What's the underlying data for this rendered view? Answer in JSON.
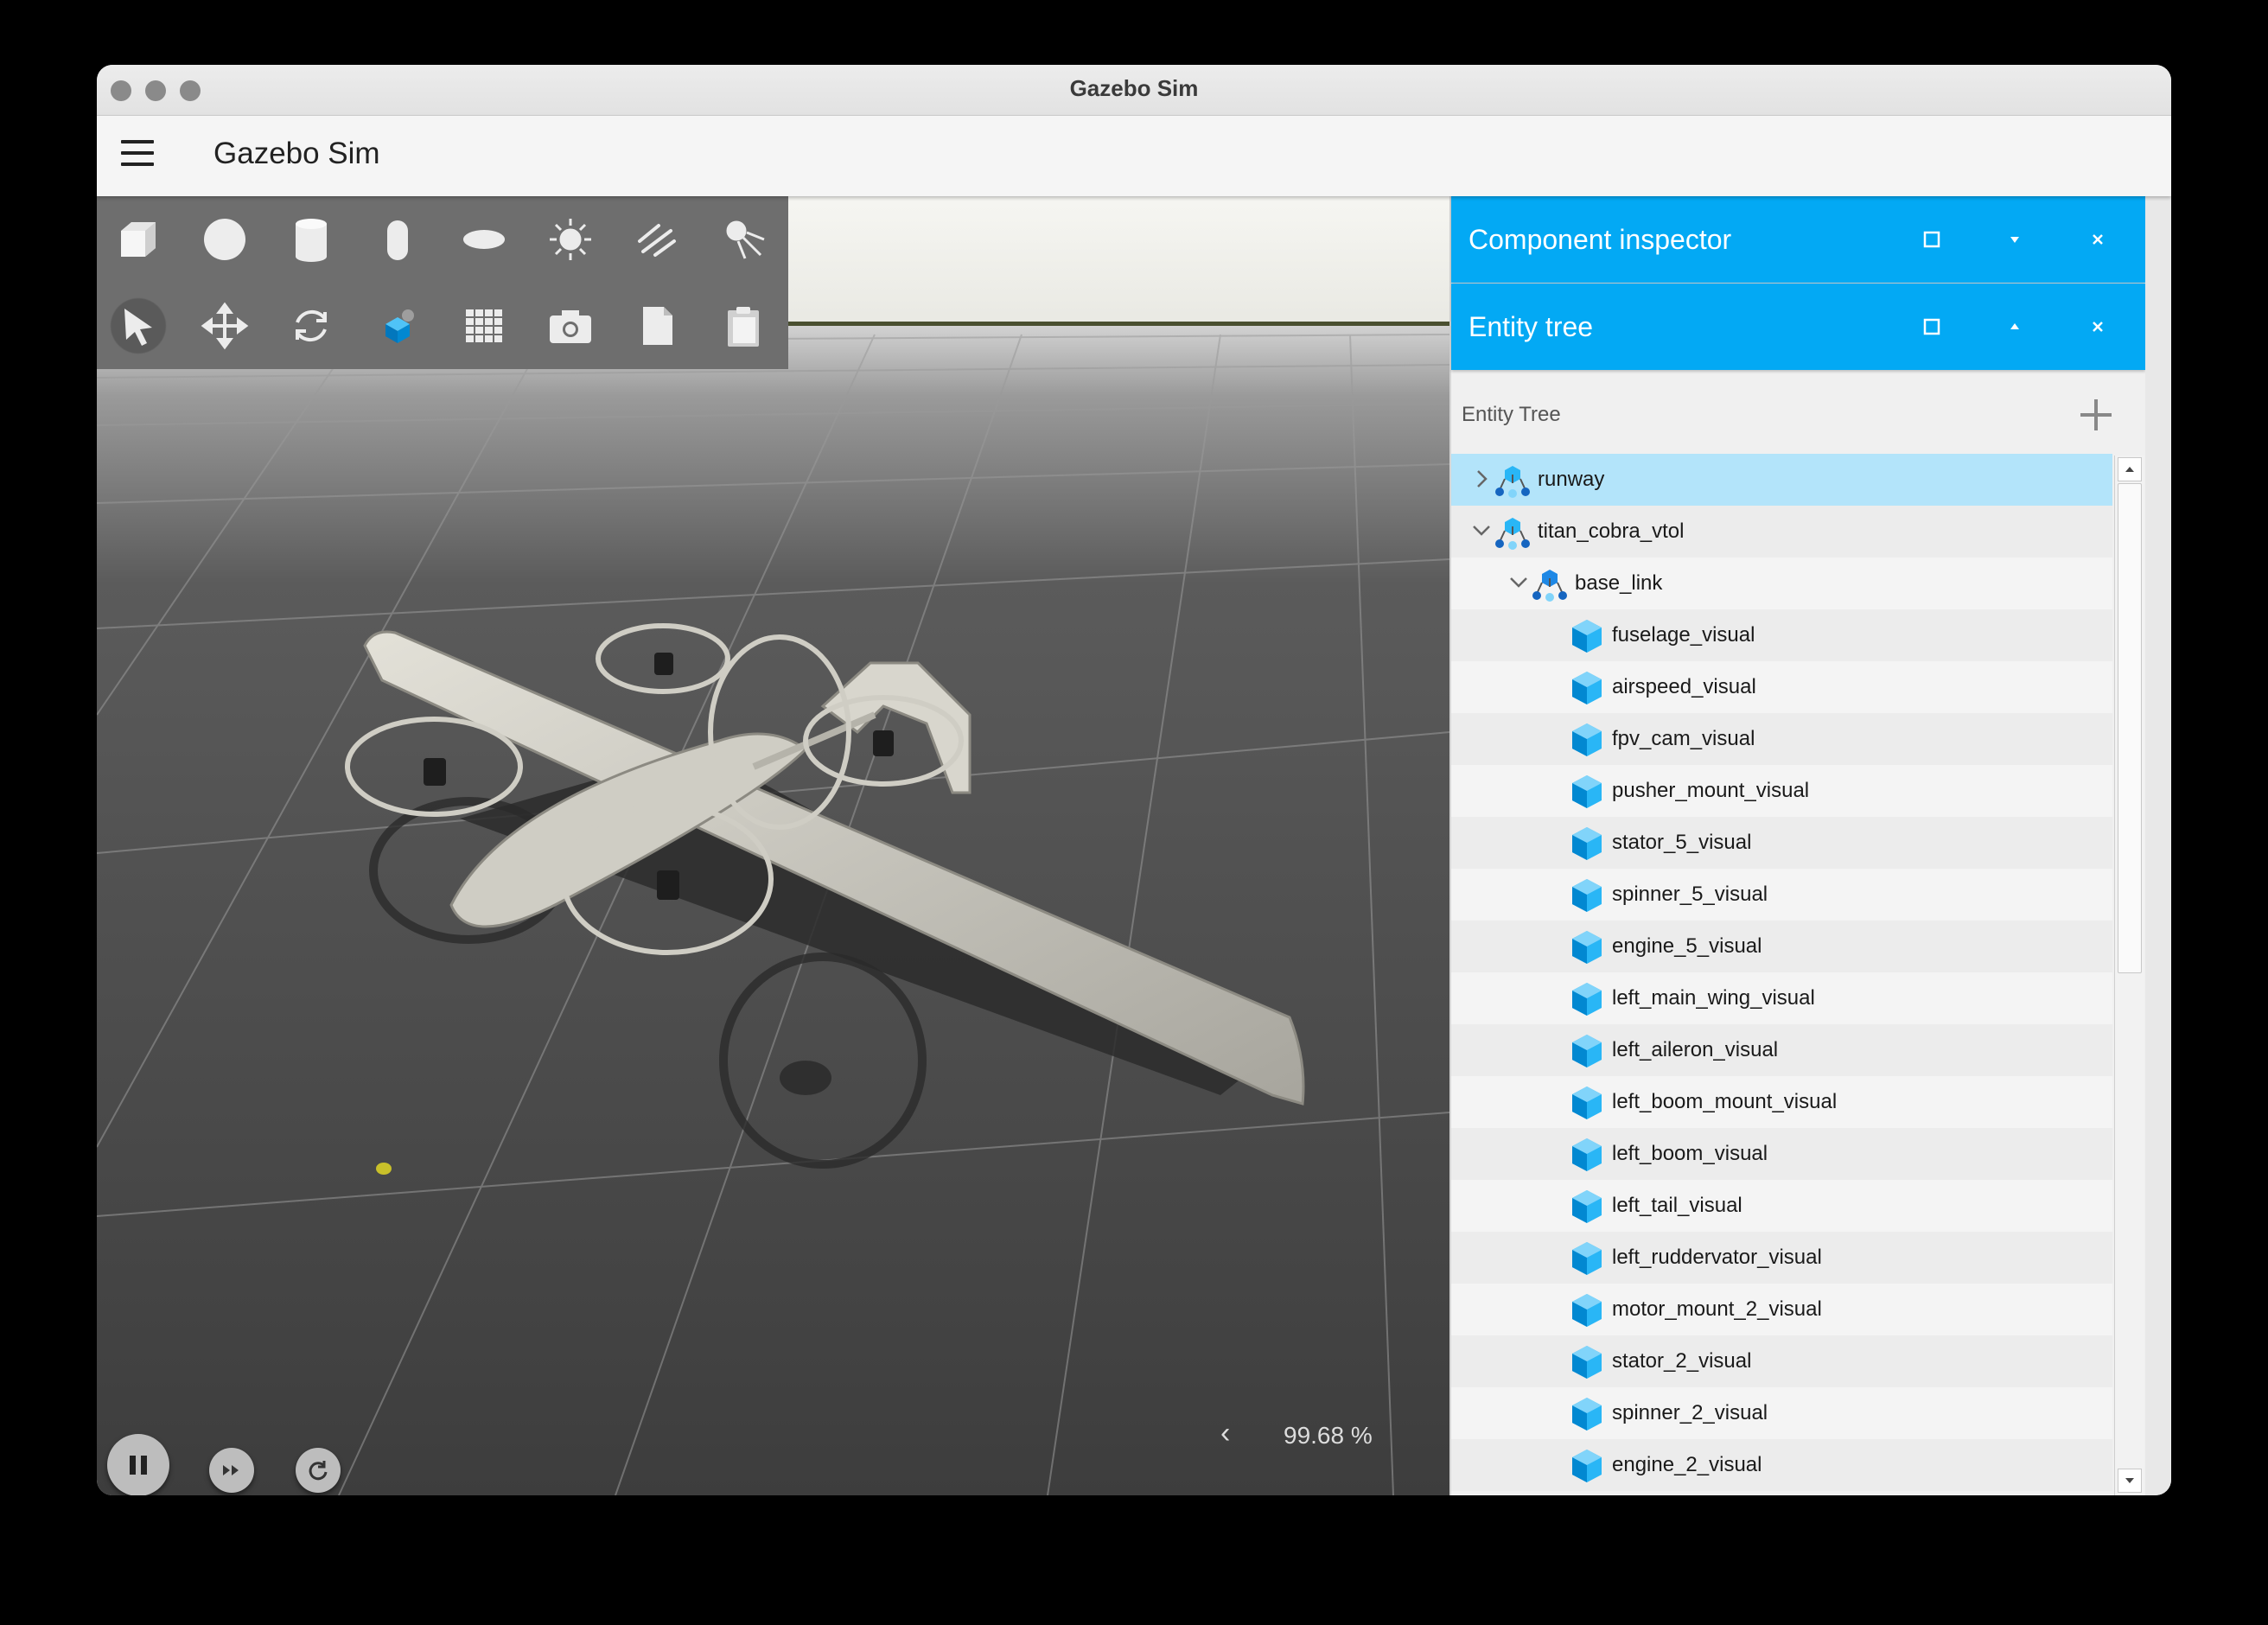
{
  "window": {
    "title": "Gazebo Sim"
  },
  "appbar": {
    "title": "Gazebo Sim"
  },
  "toolbar": {
    "shapes": [
      "box-icon",
      "sphere-icon",
      "cylinder-icon",
      "capsule-icon",
      "ellipsoid-icon",
      "sun-icon",
      "directional-light-icon",
      "spot-light-icon"
    ],
    "tools": [
      "select-arrow-icon",
      "translate-icon",
      "rotate-icon",
      "transform-mode-icon",
      "grid-config-icon",
      "camera-icon",
      "copy-icon",
      "paste-icon"
    ]
  },
  "controls": {
    "play_state": "running"
  },
  "rtf": {
    "value": "99.68 %"
  },
  "panels": {
    "component_inspector": {
      "title": "Component inspector"
    },
    "entity_tree": {
      "title": "Entity tree"
    }
  },
  "entity_tree": {
    "label": "Entity Tree",
    "items": [
      {
        "name": "runway",
        "type": "model",
        "depth": 0,
        "expander": "collapsed",
        "selected": true
      },
      {
        "name": "titan_cobra_vtol",
        "type": "model",
        "depth": 0,
        "expander": "expanded",
        "selected": false
      },
      {
        "name": "base_link",
        "type": "link",
        "depth": 1,
        "expander": "expanded",
        "selected": false
      },
      {
        "name": "fuselage_visual",
        "type": "visual",
        "depth": 2,
        "expander": "none",
        "selected": false
      },
      {
        "name": "airspeed_visual",
        "type": "visual",
        "depth": 2,
        "expander": "none",
        "selected": false
      },
      {
        "name": "fpv_cam_visual",
        "type": "visual",
        "depth": 2,
        "expander": "none",
        "selected": false
      },
      {
        "name": "pusher_mount_visual",
        "type": "visual",
        "depth": 2,
        "expander": "none",
        "selected": false
      },
      {
        "name": "stator_5_visual",
        "type": "visual",
        "depth": 2,
        "expander": "none",
        "selected": false
      },
      {
        "name": "spinner_5_visual",
        "type": "visual",
        "depth": 2,
        "expander": "none",
        "selected": false
      },
      {
        "name": "engine_5_visual",
        "type": "visual",
        "depth": 2,
        "expander": "none",
        "selected": false
      },
      {
        "name": "left_main_wing_visual",
        "type": "visual",
        "depth": 2,
        "expander": "none",
        "selected": false
      },
      {
        "name": "left_aileron_visual",
        "type": "visual",
        "depth": 2,
        "expander": "none",
        "selected": false
      },
      {
        "name": "left_boom_mount_visual",
        "type": "visual",
        "depth": 2,
        "expander": "none",
        "selected": false
      },
      {
        "name": "left_boom_visual",
        "type": "visual",
        "depth": 2,
        "expander": "none",
        "selected": false
      },
      {
        "name": "left_tail_visual",
        "type": "visual",
        "depth": 2,
        "expander": "none",
        "selected": false
      },
      {
        "name": "left_ruddervator_visual",
        "type": "visual",
        "depth": 2,
        "expander": "none",
        "selected": false
      },
      {
        "name": "motor_mount_2_visual",
        "type": "visual",
        "depth": 2,
        "expander": "none",
        "selected": false
      },
      {
        "name": "stator_2_visual",
        "type": "visual",
        "depth": 2,
        "expander": "none",
        "selected": false
      },
      {
        "name": "spinner_2_visual",
        "type": "visual",
        "depth": 2,
        "expander": "none",
        "selected": false
      },
      {
        "name": "engine_2_visual",
        "type": "visual",
        "depth": 2,
        "expander": "none",
        "selected": false
      }
    ]
  },
  "colors": {
    "accent": "#03a9f4",
    "selection": "#b3e4fa",
    "visual_icon": "#29b6f6"
  }
}
